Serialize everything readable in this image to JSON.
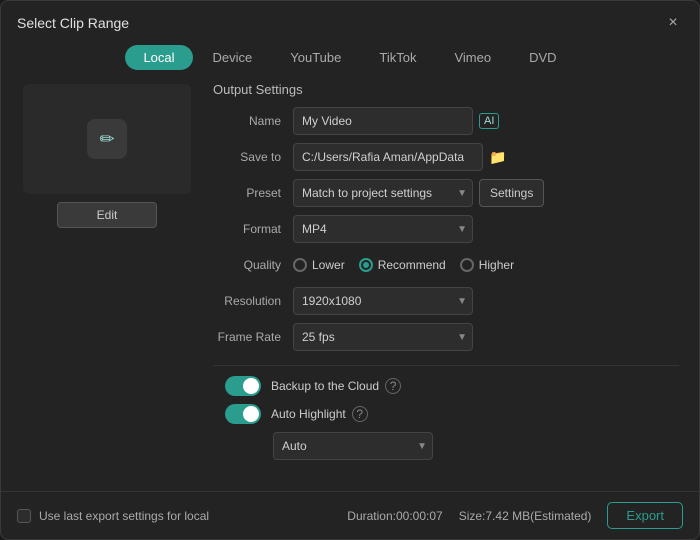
{
  "dialog": {
    "title": "Select Clip Range",
    "close_label": "×"
  },
  "tabs": [
    {
      "id": "local",
      "label": "Local",
      "active": true
    },
    {
      "id": "device",
      "label": "Device",
      "active": false
    },
    {
      "id": "youtube",
      "label": "YouTube",
      "active": false
    },
    {
      "id": "tiktok",
      "label": "TikTok",
      "active": false
    },
    {
      "id": "vimeo",
      "label": "Vimeo",
      "active": false
    },
    {
      "id": "dvd",
      "label": "DVD",
      "active": false
    }
  ],
  "left_panel": {
    "edit_button": "Edit",
    "pencil_symbol": "✏"
  },
  "output_settings": {
    "section_title": "Output Settings",
    "name_label": "Name",
    "name_value": "My Video",
    "ai_label": "AI",
    "saveto_label": "Save to",
    "saveto_value": "C:/Users/Rafia Aman/AppData",
    "preset_label": "Preset",
    "preset_value": "Match to project settings",
    "settings_button": "Settings",
    "format_label": "Format",
    "format_value": "MP4",
    "quality_label": "Quality",
    "quality_options": [
      {
        "id": "lower",
        "label": "Lower",
        "selected": false
      },
      {
        "id": "recommend",
        "label": "Recommend",
        "selected": true
      },
      {
        "id": "higher",
        "label": "Higher",
        "selected": false
      }
    ],
    "resolution_label": "Resolution",
    "resolution_value": "1920x1080",
    "framerate_label": "Frame Rate",
    "framerate_value": "25 fps",
    "backup_label": "Backup to the Cloud",
    "backup_enabled": true,
    "autohighlight_label": "Auto Highlight",
    "autohighlight_enabled": true,
    "autohighlight_dropdown": "Auto"
  },
  "bottom": {
    "checkbox_label": "Use last export settings for local",
    "duration_label": "Duration:00:00:07",
    "size_label": "Size:7.42 MB(Estimated)",
    "export_button": "Export"
  }
}
